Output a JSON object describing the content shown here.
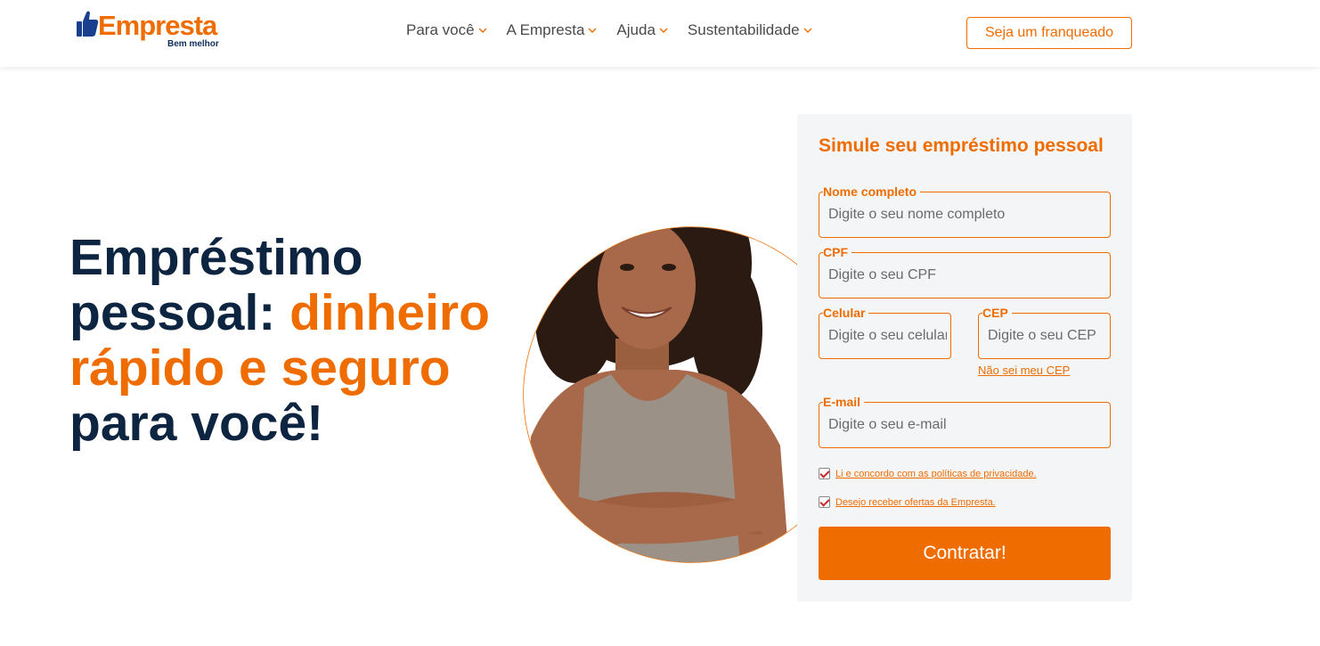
{
  "brand": {
    "name": "Empresta",
    "tagline": "Bem melhor",
    "primary_color": "#ef6c00",
    "dark_color": "#0d2540"
  },
  "nav": {
    "items": [
      {
        "label": "Para você",
        "icon": "chevron-down-icon"
      },
      {
        "label": "A Empresta",
        "icon": "chevron-down-icon"
      },
      {
        "label": "Ajuda",
        "icon": "chevron-down-icon"
      },
      {
        "label": "Sustentabilidade",
        "icon": "chevron-down-icon"
      }
    ],
    "cta_label": "Seja um franqueado"
  },
  "hero": {
    "line1": "Empréstimo",
    "line2_dark": "pessoal: ",
    "line2_accent": "dinheiro",
    "line3_accent": "rápido e seguro",
    "line4": "para você!"
  },
  "form": {
    "title": "Simule seu empréstimo pessoal",
    "name": {
      "label": "Nome completo",
      "placeholder": "Digite o seu nome completo"
    },
    "cpf": {
      "label": "CPF",
      "placeholder": "Digite o seu CPF"
    },
    "phone": {
      "label": "Celular",
      "placeholder": "Digite o seu celular"
    },
    "cep": {
      "label": "CEP",
      "placeholder": "Digite o seu CEP"
    },
    "cep_link": "Não sei meu CEP",
    "email": {
      "label": "E-mail",
      "placeholder": "Digite o seu e-mail"
    },
    "privacy_check": {
      "label": "Li e concordo com as políticas de privacidade.",
      "checked": true
    },
    "offers_check": {
      "label": "Desejo receber ofertas da Empresta.",
      "checked": true
    },
    "submit_label": "Contratar!"
  }
}
